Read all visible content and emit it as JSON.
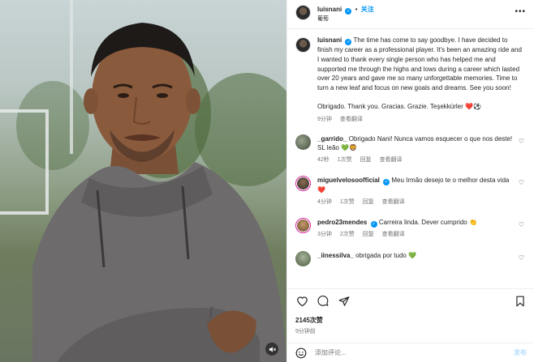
{
  "header": {
    "username": "luisnani",
    "verified_mark": "✓",
    "separator": "•",
    "follow_label": "关注",
    "location": "葡萄",
    "more_icon": "more-horizontal-icon"
  },
  "caption": {
    "username": "luisnani",
    "text": "The time has come to say goodbye. I have decided to finish my career as a professional player. It's been an amazing ride and I wanted to thank every single person who has helped me and supported me through the highs and lows during a career which lasted over 20 years and gave me so many unforgettable memories. Time to turn a new leaf and focus on new goals and dreams. See you soon!",
    "text2": "Obrigado. Thank you. Gracias. Grazie. Teşekkürler ❤️⚽",
    "time": "9分钟",
    "translate": "查看翻译"
  },
  "comments": [
    {
      "username": "_garrido_",
      "text": "Obrigado Nani! Nunca vamos esquecer o que nos deste! SL leão 💚🦁",
      "time": "42秒",
      "likes": "1次赞",
      "reply": "回复",
      "translate": "查看翻译"
    },
    {
      "username": "miguelvelosoofficial",
      "verified": "✓",
      "text": "Meu Irmão desejo te o melhor desta vida ❤️",
      "time": "4分钟",
      "likes": "1次赞",
      "reply": "回复",
      "translate": "查看翻译"
    },
    {
      "username": "pedro23mendes",
      "verified": "✓",
      "text": "Carreira linda. Dever cumprido 👏",
      "time": "3分钟",
      "likes": "2次赞",
      "reply": "回复",
      "translate": "查看翻译"
    },
    {
      "username": "_iinessilva_",
      "text": "obrigada por tudo 💚",
      "time": "",
      "likes": "",
      "reply": "",
      "translate": ""
    }
  ],
  "actions": {
    "likes": "2145次赞",
    "time": "9分钟前"
  },
  "add_comment": {
    "placeholder": "添加评论...",
    "post_label": "发布"
  },
  "colors": {
    "accent": "#0095f6",
    "heart_red": "#e0245e",
    "muted": "#737373"
  }
}
